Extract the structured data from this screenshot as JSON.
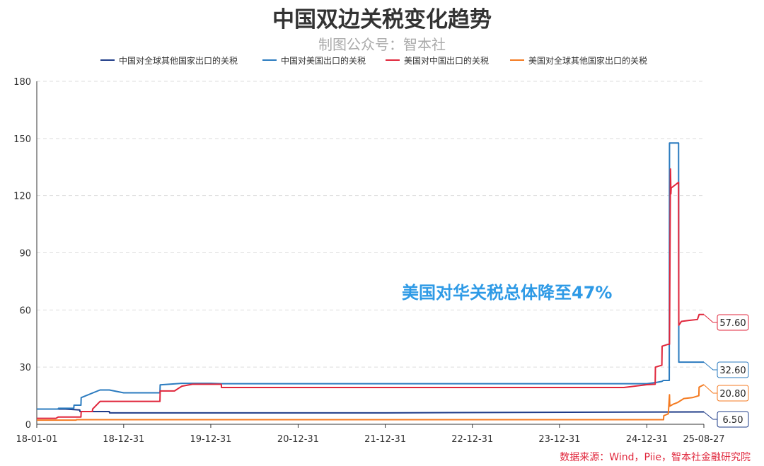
{
  "colors": {
    "series_cn_world": "#1f3c88",
    "series_cn_us": "#2b7bbf",
    "series_us_cn": "#e0263b",
    "series_us_world": "#f47a20",
    "annotation": "#2e9ae6",
    "source": "#e0263b",
    "grid": "#dddddd",
    "axis": "#333333"
  },
  "chart_data": {
    "type": "line",
    "title": "中国双边关税变化趋势",
    "subtitle": "制图公众号：智本社",
    "annotation": "美国对华关税总体降至47%",
    "source": "数据来源：Wind，Piie，智本社金融研究院",
    "xlabel": "",
    "ylabel": "",
    "x_range": [
      "2018-01-01",
      "2025-08-27"
    ],
    "x_ticks": [
      "18-01-01",
      "18-12-31",
      "19-12-31",
      "20-12-31",
      "21-12-31",
      "22-12-31",
      "23-12-31",
      "24-12-31",
      "25-08-27"
    ],
    "ylim": [
      0,
      180
    ],
    "y_ticks": [
      0,
      30,
      60,
      90,
      120,
      150,
      180
    ],
    "grid": "horizontal dashed",
    "legend_position": "top",
    "end_labels": [
      "57.60",
      "32.60",
      "20.80",
      "6.50"
    ],
    "series": [
      {
        "name": "中国对全球其他国家出口的关税",
        "color": "#1f3c88",
        "points": [
          [
            "2018-01-01",
            8.0
          ],
          [
            "2018-05-01",
            8.0
          ],
          [
            "2018-06-30",
            7.5
          ],
          [
            "2018-07-01",
            6.7
          ],
          [
            "2018-11-01",
            6.7
          ],
          [
            "2018-11-02",
            6.0
          ],
          [
            "2022-01-01",
            6.0
          ],
          [
            "2025-08-27",
            6.5
          ]
        ]
      },
      {
        "name": "中国对美国出口的关税",
        "color": "#2b7bbf",
        "points": [
          [
            "2018-01-01",
            8.0
          ],
          [
            "2018-03-31",
            8.0
          ],
          [
            "2018-04-02",
            8.4
          ],
          [
            "2018-06-05",
            8.4
          ],
          [
            "2018-06-06",
            10.0
          ],
          [
            "2018-07-05",
            10.0
          ],
          [
            "2018-07-06",
            14.0
          ],
          [
            "2018-09-23",
            18.0
          ],
          [
            "2018-11-01",
            18.0
          ],
          [
            "2018-12-31",
            16.5
          ],
          [
            "2019-06-01",
            16.5
          ],
          [
            "2019-06-02",
            20.7
          ],
          [
            "2019-09-01",
            21.5
          ],
          [
            "2019-12-31",
            21.5
          ],
          [
            "2020-02-14",
            21.3
          ],
          [
            "2024-12-31",
            21.3
          ],
          [
            "2025-02-10",
            22.0
          ],
          [
            "2025-03-04",
            22.5
          ],
          [
            "2025-03-10",
            23.0
          ],
          [
            "2025-04-04",
            23.0
          ],
          [
            "2025-04-05",
            147.6
          ],
          [
            "2025-05-13",
            147.6
          ],
          [
            "2025-05-14",
            32.6
          ],
          [
            "2025-08-27",
            32.6
          ]
        ]
      },
      {
        "name": "美国对中国出口的关税",
        "color": "#e0263b",
        "points": [
          [
            "2018-01-01",
            3.1
          ],
          [
            "2018-03-22",
            3.1
          ],
          [
            "2018-04-01",
            3.8
          ],
          [
            "2018-07-05",
            3.8
          ],
          [
            "2018-07-06",
            6.7
          ],
          [
            "2018-08-22",
            6.7
          ],
          [
            "2018-08-23",
            8.0
          ],
          [
            "2018-09-23",
            12.0
          ],
          [
            "2019-06-01",
            12.0
          ],
          [
            "2019-06-02",
            17.5
          ],
          [
            "2019-08-01",
            17.5
          ],
          [
            "2019-09-01",
            20.0
          ],
          [
            "2019-10-15",
            21.0
          ],
          [
            "2020-02-13",
            21.0
          ],
          [
            "2020-02-14",
            19.3
          ],
          [
            "2024-09-26",
            19.3
          ],
          [
            "2024-12-31",
            20.8
          ],
          [
            "2025-02-04",
            21.0
          ],
          [
            "2025-02-05",
            30.0
          ],
          [
            "2025-03-04",
            31.0
          ],
          [
            "2025-03-05",
            41.0
          ],
          [
            "2025-03-31",
            42.0
          ],
          [
            "2025-04-05",
            42.0
          ],
          [
            "2025-04-09",
            134.0
          ],
          [
            "2025-04-11",
            121.0
          ],
          [
            "2025-04-12",
            124.0
          ],
          [
            "2025-05-13",
            127.0
          ],
          [
            "2025-05-14",
            52.0
          ],
          [
            "2025-05-25",
            54.0
          ],
          [
            "2025-06-25",
            54.5
          ],
          [
            "2025-07-31",
            55.0
          ],
          [
            "2025-08-07",
            57.6
          ],
          [
            "2025-08-27",
            57.6
          ]
        ]
      },
      {
        "name": "美国对全球其他国家出口的关税",
        "color": "#f47a20",
        "points": [
          [
            "2018-01-01",
            2.2
          ],
          [
            "2018-06-15",
            2.2
          ],
          [
            "2018-06-16",
            2.4
          ],
          [
            "2024-12-31",
            2.4
          ],
          [
            "2025-03-11",
            2.4
          ],
          [
            "2025-03-12",
            4.5
          ],
          [
            "2025-03-31",
            5.5
          ],
          [
            "2025-04-05",
            15.5
          ],
          [
            "2025-04-06",
            9.5
          ],
          [
            "2025-04-20",
            10.5
          ],
          [
            "2025-05-10",
            11.5
          ],
          [
            "2025-06-04",
            13.5
          ],
          [
            "2025-07-10",
            14.0
          ],
          [
            "2025-08-06",
            15.0
          ],
          [
            "2025-08-07",
            19.5
          ],
          [
            "2025-08-27",
            20.8
          ]
        ]
      }
    ]
  }
}
